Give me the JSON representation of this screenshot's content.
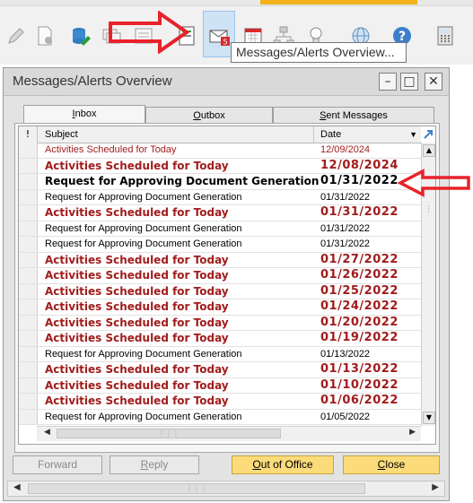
{
  "toolbar": {
    "icons": [
      "pencil-icon",
      "document-settings-icon",
      "database-edit-icon",
      "chat-icon",
      "note-icon",
      "form-icon",
      "messages-alerts-icon",
      "calendar-icon",
      "network-icon",
      "lightbulb-icon",
      "globe-icon",
      "help-icon",
      "calculator-icon"
    ],
    "tooltip": "Messages/Alerts Overview..."
  },
  "window": {
    "title": "Messages/Alerts Overview",
    "controls": [
      "minimize",
      "maximize",
      "close"
    ]
  },
  "tabs": [
    {
      "label": "Inbox",
      "mnemonic": "I",
      "rest": "nbox"
    },
    {
      "label": "Outbox",
      "mnemonic": "O",
      "rest": "utbox"
    },
    {
      "label": "Sent Messages",
      "mnemonic": "S",
      "rest": "ent Messages"
    }
  ],
  "grid": {
    "col_flag": "!",
    "col_subject": "Subject",
    "col_date": "Date",
    "rows": [
      {
        "subject": "Activities Scheduled for Today",
        "date": "12/09/2024",
        "style": "redlite"
      },
      {
        "subject": "Activities Scheduled for Today",
        "date": "12/08/2024",
        "style": "red"
      },
      {
        "subject": "Request for Approving Document Generation",
        "date": "01/31/2022",
        "style": "bold"
      },
      {
        "subject": "Request for Approving Document Generation",
        "date": "01/31/2022",
        "style": "normal"
      },
      {
        "subject": "Activities Scheduled for Today",
        "date": "01/31/2022",
        "style": "red"
      },
      {
        "subject": "Request for Approving Document Generation",
        "date": "01/31/2022",
        "style": "normal"
      },
      {
        "subject": "Request for Approving Document Generation",
        "date": "01/31/2022",
        "style": "normal"
      },
      {
        "subject": "Activities Scheduled for Today",
        "date": "01/27/2022",
        "style": "red"
      },
      {
        "subject": "Activities Scheduled for Today",
        "date": "01/26/2022",
        "style": "red"
      },
      {
        "subject": "Activities Scheduled for Today",
        "date": "01/25/2022",
        "style": "red"
      },
      {
        "subject": "Activities Scheduled for Today",
        "date": "01/24/2022",
        "style": "red"
      },
      {
        "subject": "Activities Scheduled for Today",
        "date": "01/20/2022",
        "style": "red"
      },
      {
        "subject": "Activities Scheduled for Today",
        "date": "01/19/2022",
        "style": "red"
      },
      {
        "subject": "Request for Approving Document Generation",
        "date": "01/13/2022",
        "style": "normal"
      },
      {
        "subject": "Activities Scheduled for Today",
        "date": "01/13/2022",
        "style": "red"
      },
      {
        "subject": "Activities Scheduled for Today",
        "date": "01/10/2022",
        "style": "red"
      },
      {
        "subject": "Activities Scheduled for Today",
        "date": "01/06/2022",
        "style": "red"
      },
      {
        "subject": "Request for Approving Document Generation",
        "date": "01/05/2022",
        "style": "normal"
      }
    ]
  },
  "buttons": {
    "forward": {
      "label": "Forward",
      "mnemonic": "",
      "rest": "Forward"
    },
    "reply": {
      "label": "Reply",
      "mnemonic": "R",
      "rest": "eply"
    },
    "out_of_office": {
      "label": "Out of Office",
      "mnemonic": "O",
      "rest": "ut of Office"
    },
    "close": {
      "label": "Close",
      "mnemonic": "C",
      "rest": "lose"
    }
  },
  "colors": {
    "accent_red": "#a11c1c",
    "annotation_red": "#e8222a",
    "button_yellow": "#fbdb7a",
    "selection_blue": "#cfe3f7"
  }
}
